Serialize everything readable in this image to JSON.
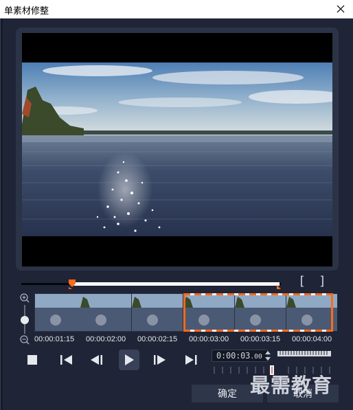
{
  "window": {
    "title": "单素材修整"
  },
  "trim": {
    "mark_in": "[",
    "mark_out": "]"
  },
  "timeline": {
    "timecodes": [
      "00:00:01:15",
      "00:00:02:00",
      "00:00:02:15",
      "00:00:03:00",
      "00:00:03:15",
      "00:00:04:00"
    ]
  },
  "transport": {
    "timecode": "0:00:03",
    "timecode_frames": ".00"
  },
  "buttons": {
    "ok": "确定",
    "cancel": "取消"
  },
  "watermark": "最需教育",
  "colors": {
    "accent": "#ff6a1a",
    "background": "#1f2536",
    "panel": "#2b3346",
    "button": "#2e364a"
  },
  "icons": [
    "close-icon",
    "zoom-in-icon",
    "zoom-out-icon",
    "stop-icon",
    "go-to-start-icon",
    "previous-frame-icon",
    "play-icon",
    "next-frame-icon",
    "go-to-end-icon",
    "timecode-spinner-icon"
  ]
}
